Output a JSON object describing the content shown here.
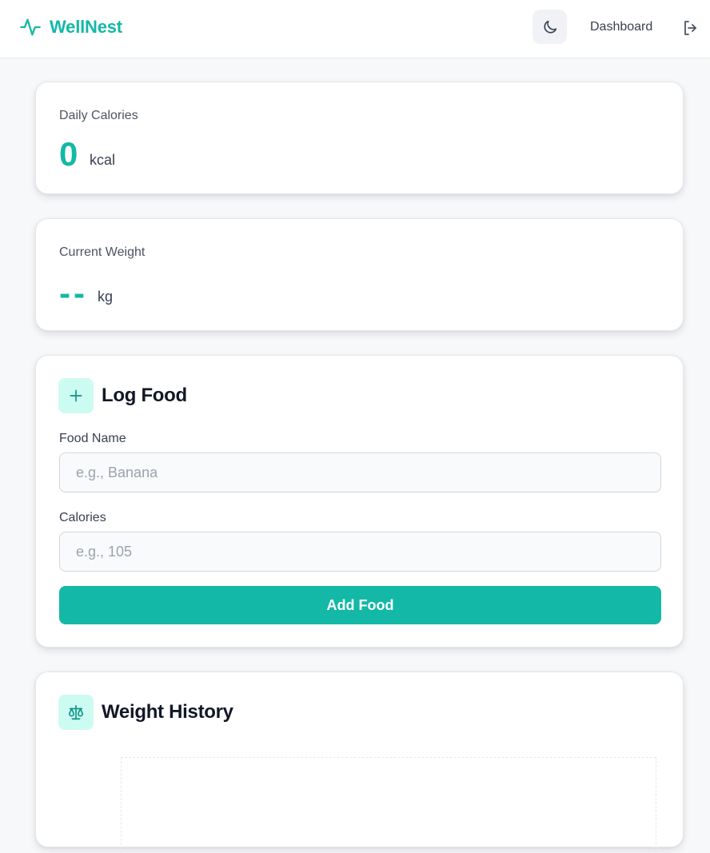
{
  "app": {
    "name": "WellNest"
  },
  "nav": {
    "dashboard_label": "Dashboard",
    "theme_icon": "moon-icon",
    "logout_icon": "logout-icon"
  },
  "calories": {
    "label": "Daily Calories",
    "value": "0",
    "unit": "kcal"
  },
  "weight": {
    "label": "Current Weight",
    "value": "--",
    "unit": "kg"
  },
  "log_food": {
    "title": "Log Food",
    "icon": "plus-icon",
    "food_name_label": "Food Name",
    "food_name_placeholder": "e.g., Banana",
    "food_name_value": "",
    "calories_label": "Calories",
    "calories_placeholder": "e.g., 105",
    "calories_value": "",
    "submit_label": "Add Food"
  },
  "weight_history": {
    "title": "Weight History",
    "icon": "scale-icon"
  },
  "colors": {
    "accent": "#14b8a6",
    "accent_soft": "#ccfbf1",
    "background": "#f7f8fa"
  }
}
